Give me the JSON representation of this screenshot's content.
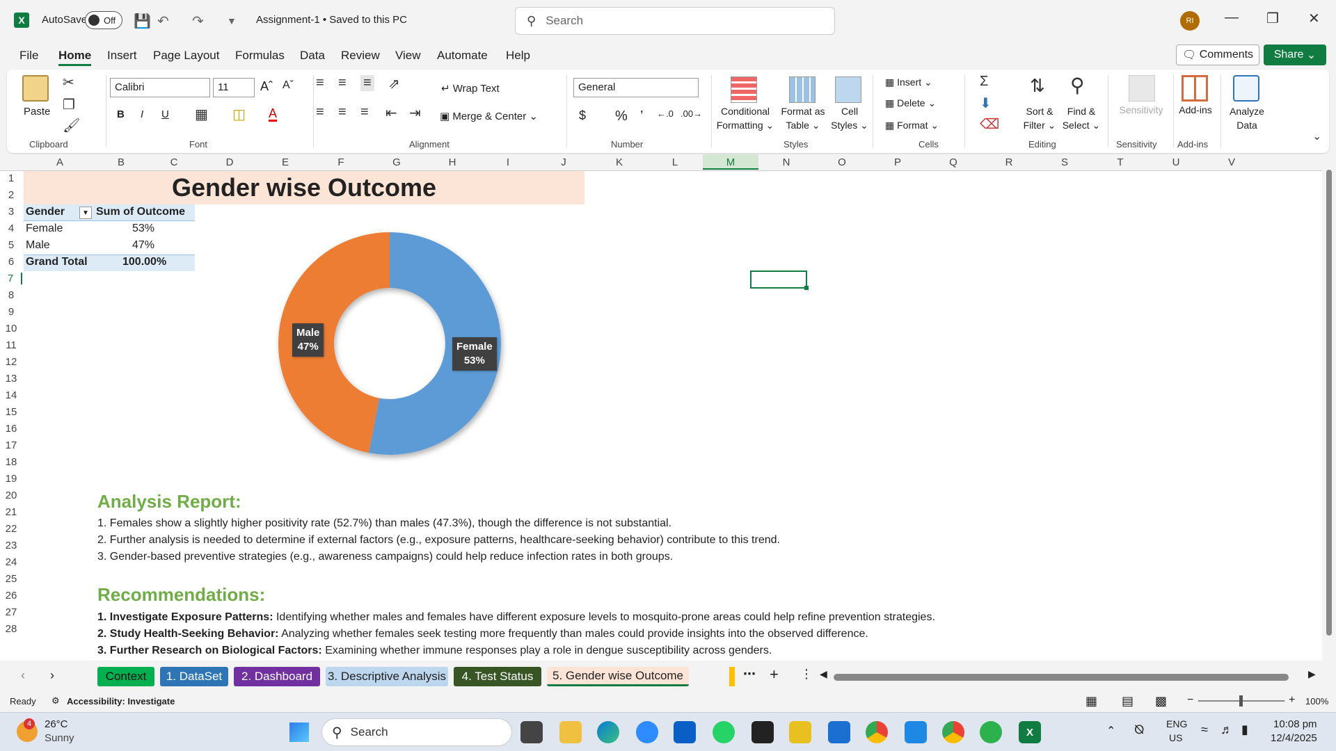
{
  "window": {
    "autosave_label": "AutoSave",
    "autosave_state": "Off",
    "doc_title": "Assignment-1 • Saved to this PC",
    "search_placeholder": "Search",
    "avatar_initials": "RI"
  },
  "menu_tabs": [
    "File",
    "Home",
    "Insert",
    "Page Layout",
    "Formulas",
    "Data",
    "Review",
    "View",
    "Automate",
    "Help"
  ],
  "active_menu_tab": "Home",
  "comments_label": "Comments",
  "share_label": "Share",
  "ribbon": {
    "clipboard": {
      "paste": "Paste",
      "label": "Clipboard"
    },
    "font": {
      "name": "Calibri",
      "size": "11",
      "label": "Font",
      "bold": "B",
      "italic": "I",
      "underline": "U"
    },
    "alignment": {
      "wrap_text": "Wrap Text",
      "merge_center": "Merge & Center",
      "label": "Alignment"
    },
    "number": {
      "format": "General",
      "label": "Number"
    },
    "styles": {
      "conditional_1": "Conditional",
      "conditional_2": "Formatting",
      "format_table_1": "Format as",
      "format_table_2": "Table",
      "cell_styles_1": "Cell",
      "cell_styles_2": "Styles",
      "label": "Styles"
    },
    "cells": {
      "insert": "Insert",
      "delete": "Delete",
      "format": "Format",
      "label": "Cells"
    },
    "editing": {
      "sort_1": "Sort &",
      "sort_2": "Filter",
      "find_1": "Find &",
      "find_2": "Select",
      "label": "Editing"
    },
    "sensitivity": {
      "btn": "Sensitivity",
      "label": "Sensitivity"
    },
    "addins": {
      "btn": "Add-ins",
      "label": "Add-ins"
    },
    "analyze": {
      "btn_1": "Analyze",
      "btn_2": "Data"
    }
  },
  "columns": [
    "A",
    "B",
    "C",
    "D",
    "E",
    "F",
    "G",
    "H",
    "I",
    "J",
    "K",
    "L",
    "M",
    "N",
    "O",
    "P",
    "Q",
    "R",
    "S",
    "T",
    "U",
    "V"
  ],
  "rows": [
    "1",
    "2",
    "3",
    "4",
    "5",
    "6",
    "7",
    "8",
    "9",
    "10",
    "11",
    "12",
    "13",
    "14",
    "15",
    "16",
    "17",
    "18",
    "19",
    "20",
    "21",
    "22",
    "23",
    "24",
    "25",
    "26",
    "27",
    "28"
  ],
  "sheet": {
    "title": "Gender wise Outcome",
    "pivot": {
      "header_gender": "Gender",
      "header_outcome": "Sum of Outcome",
      "rows": [
        {
          "label": "Female",
          "value": "53%"
        },
        {
          "label": "Male",
          "value": "47%"
        }
      ],
      "total_label": "Grand Total",
      "total_value": "100.00%"
    },
    "analysis_head": "Analysis Report:",
    "analysis_lines": [
      "1. Females show a slightly higher positivity rate (52.7%) than males (47.3%), though the difference is not substantial.",
      "2. Further analysis is needed to determine if external factors (e.g., exposure patterns, healthcare-seeking behavior) contribute to this trend.",
      "3. Gender-based preventive strategies (e.g., awareness campaigns) could help reduce infection rates in both groups."
    ],
    "recs_head": "Recommendations:",
    "recs": [
      {
        "bold": "1. Investigate Exposure Patterns:",
        "text": " Identifying whether males and females have different exposure levels to mosquito-prone areas could help refine prevention strategies."
      },
      {
        "bold": "2. Study Health-Seeking Behavior:",
        "text": " Analyzing whether females seek testing more frequently than males could provide insights into the observed difference."
      },
      {
        "bold": "3. Further Research on Biological Factors:",
        "text": " Examining whether immune responses play a role in dengue susceptibility across genders."
      }
    ]
  },
  "chart_data": {
    "type": "pie",
    "variant": "doughnut",
    "categories": [
      "Female",
      "Male"
    ],
    "values": [
      53,
      47
    ],
    "labels": [
      "53%",
      "47%"
    ],
    "colors": [
      "#5b9bd5",
      "#ed7d31"
    ]
  },
  "sheet_tabs": [
    {
      "label": "Context",
      "bg": "#00b050",
      "fg": "#111"
    },
    {
      "label": "1. DataSet",
      "bg": "#2e75b6",
      "fg": "#fff"
    },
    {
      "label": "2. Dashboard",
      "bg": "#7030a0",
      "fg": "#fff"
    },
    {
      "label": "3. Descriptive Analysis",
      "bg": "#bdd7ee",
      "fg": "#222"
    },
    {
      "label": "4. Test Status",
      "bg": "#375623",
      "fg": "#fff"
    },
    {
      "label": "5. Gender wise Outcome",
      "bg": "#fce4d6",
      "fg": "#222"
    }
  ],
  "status": {
    "ready": "Ready",
    "accessibility": "Accessibility: Investigate",
    "zoom": "100%"
  },
  "taskbar": {
    "weather_temp": "26°C",
    "weather_desc": "Sunny",
    "weather_badge": "4",
    "search": "Search",
    "lang_1": "ENG",
    "lang_2": "US",
    "time": "10:08 pm",
    "date": "12/4/2025"
  }
}
